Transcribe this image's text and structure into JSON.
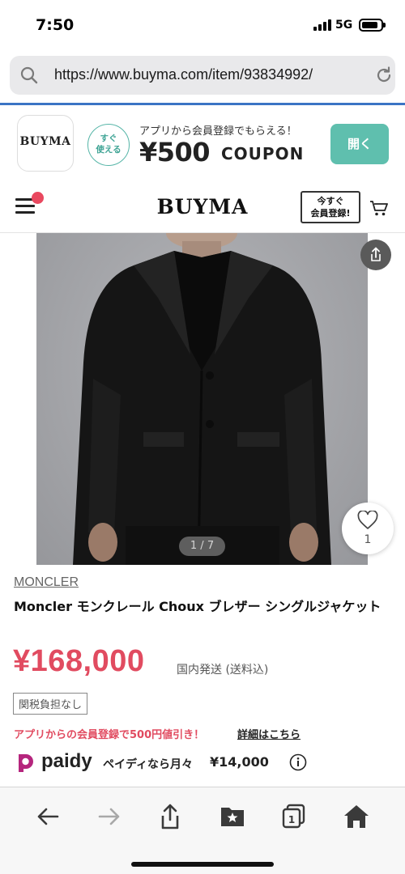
{
  "status_bar": {
    "time": "7:50",
    "network": "5G"
  },
  "browser": {
    "url": "https://www.buyma.com/item/93834992/"
  },
  "app_banner": {
    "app_name": "BUYMA",
    "badge_line1": "すぐ",
    "badge_line2": "使える",
    "message": "アプリから会員登録でもらえる！",
    "price": "¥500",
    "coupon_label": "COUPON",
    "open_label": "開く",
    "accent_color": "#5fbfae"
  },
  "header": {
    "logo": "BUYMA",
    "register_line1": "今すぐ",
    "register_line2": "会員登録!"
  },
  "product": {
    "image_counter": "1 / 7",
    "favorite_count": "1",
    "brand": "MONCLER",
    "title": "Moncler モンクレール Choux ブレザー シングルジャケット",
    "price": "¥168,000",
    "shipping": "国内発送 (送料込)",
    "tax_badge": "関税負担なし",
    "promo_text": "アプリからの会員登録で500円値引き！",
    "promo_link": "詳細はこちら",
    "price_color": "#e14b60"
  },
  "paidy": {
    "name": "paidy",
    "monthly_label": "ペイディなら月々",
    "monthly_amount": "¥14,000"
  },
  "toolbar": {
    "icons": [
      "back-icon",
      "forward-icon",
      "share-icon",
      "bookmarks-icon",
      "tabs-icon",
      "home-icon"
    ],
    "tab_count": "1"
  }
}
